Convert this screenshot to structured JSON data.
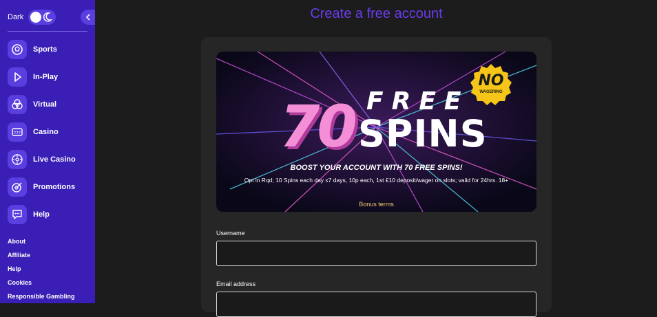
{
  "sidebar": {
    "dark_label": "Dark",
    "nav": [
      {
        "label": "Sports",
        "icon": "sports-ball-icon"
      },
      {
        "label": "In-Play",
        "icon": "play-icon"
      },
      {
        "label": "Virtual",
        "icon": "virtual-icon"
      },
      {
        "label": "Casino",
        "icon": "slot-777-icon"
      },
      {
        "label": "Live Casino",
        "icon": "roulette-icon"
      },
      {
        "label": "Promotions",
        "icon": "target-icon"
      },
      {
        "label": "Help",
        "icon": "chat-icon"
      }
    ],
    "footer_links": [
      "About",
      "Affiliate",
      "Help",
      "Cookies",
      "Responsible Gambling"
    ]
  },
  "main": {
    "title": "Create a free account",
    "banner": {
      "number": "70",
      "free": "FREE",
      "spins": "SPINS",
      "badge_top": "NO",
      "badge_bottom": "WAGERING",
      "headline": "BOOST YOUR ACCOUNT WITH 70 FREE SPINS!",
      "terms": "Opt in Rqd; 10 Spins each day x7 days, 10p each, 1st £10 deposit/wager on slots; valid for 24hrs. 18+",
      "bonus_terms": "Bonus terms"
    },
    "form": {
      "username_label": "Username",
      "username_value": "",
      "email_label": "Email address",
      "email_value": ""
    }
  },
  "colors": {
    "sidebar": "#3a1eb5",
    "accent": "#6b3cf0",
    "panel": "#262626",
    "background": "#1c1c1c",
    "bonus_link": "#f3c96b",
    "badge": "#f5c518"
  }
}
